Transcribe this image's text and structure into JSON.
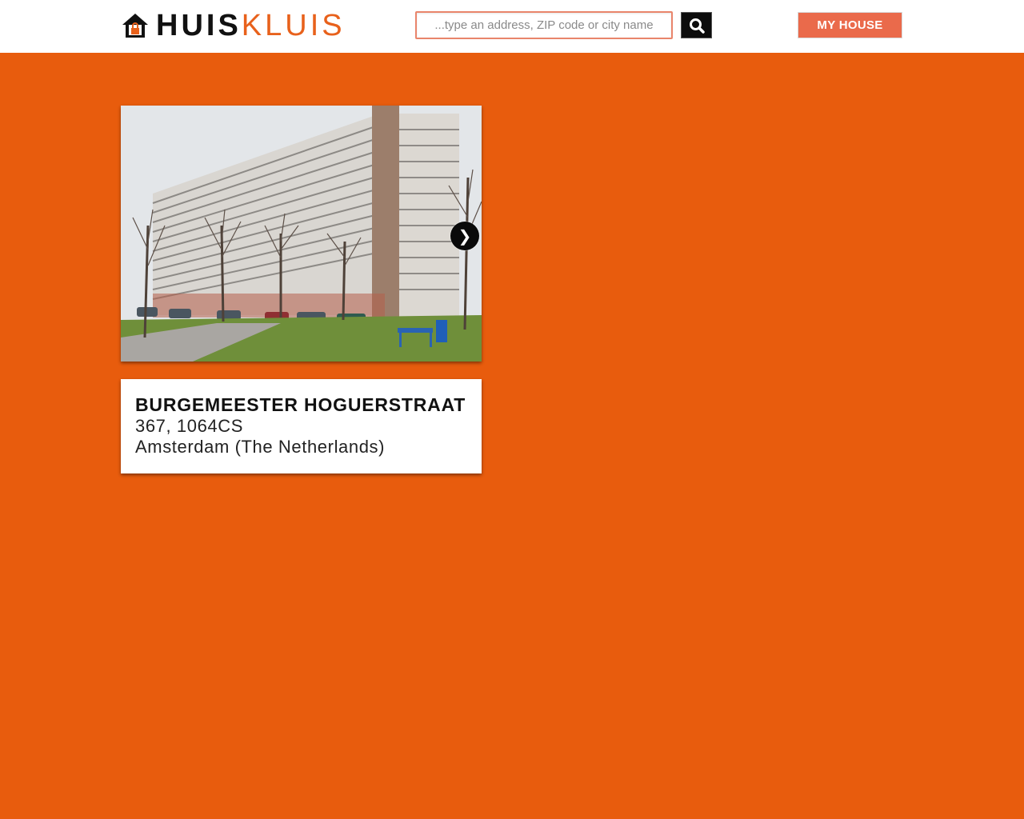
{
  "header": {
    "logo": {
      "part1": "HUIS",
      "part2": "KLUIS",
      "icon": "house-lock-icon"
    },
    "search": {
      "placeholder": "...type an address, ZIP code or city name",
      "value": "",
      "button_icon": "search-icon"
    },
    "my_house_label": "MY HOUSE"
  },
  "gallery": {
    "next_label": "❯",
    "image_alt": "Apartment building photo"
  },
  "address": {
    "street": "BURGEMEESTER HOGUERSTRAAT",
    "number_zip": "367, 1064CS",
    "city_country": "Amsterdam (The Netherlands)"
  },
  "colors": {
    "background": "#e85c0d",
    "brand_orange": "#e8611b",
    "button_bg": "#ea6a4b",
    "text_dark": "#111111"
  }
}
